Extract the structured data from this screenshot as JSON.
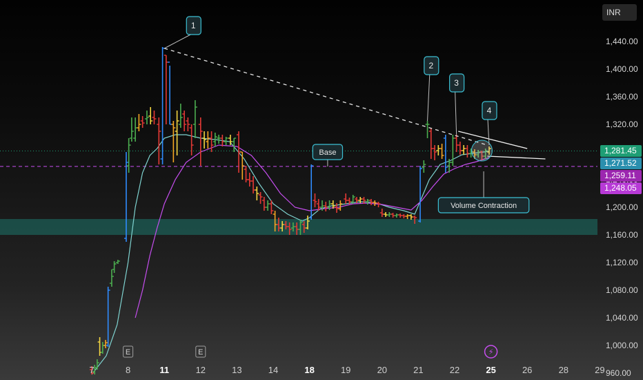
{
  "currency": "INR",
  "colors": {
    "bull_green": "#4caf50",
    "bear_red": "#e53935",
    "yellow": "#f5d742",
    "orange": "#f5a623",
    "blue": "#2f8cff",
    "ma_fast": "#7fd3d0",
    "ma_slow": "#c74ef0",
    "zone": "#1c5e55",
    "label": "#3cc0d4"
  },
  "price_tags": [
    {
      "label": "1,281.45",
      "value": 1281.45,
      "bg": "#1e9e75",
      "fg": "#ffffff"
    },
    {
      "label": "1,271.52",
      "value": 1271.52,
      "bg": "#2a8fae",
      "fg": "#ffffff"
    },
    {
      "label": "1,259.11",
      "value": 1259.11,
      "bg": "#9c27b0",
      "fg": "#ffffff"
    },
    {
      "label": "1,248.05",
      "value": 1248.05,
      "bg": "#b73ad6",
      "fg": "#ffffff"
    }
  ],
  "chart_data": {
    "type": "candlestick",
    "y_ticks": [
      "1,440.00",
      "1,400.00",
      "1,360.00",
      "1,320.00",
      "1,280.00",
      "1,240.00",
      "1,200.00",
      "1,160.00",
      "1,120.00",
      "1,080.00",
      "1,040.00",
      "1,000.00",
      "960.00"
    ],
    "y_tick_values": [
      1440,
      1400,
      1360,
      1320,
      1280,
      1240,
      1200,
      1160,
      1120,
      1080,
      1040,
      1000,
      960
    ],
    "x_ticks": [
      {
        "label": "7",
        "bold": false,
        "pos": 0
      },
      {
        "label": "8",
        "bold": false,
        "pos": 1
      },
      {
        "label": "11",
        "bold": true,
        "pos": 2
      },
      {
        "label": "12",
        "bold": false,
        "pos": 3
      },
      {
        "label": "13",
        "bold": false,
        "pos": 4
      },
      {
        "label": "14",
        "bold": false,
        "pos": 5
      },
      {
        "label": "18",
        "bold": true,
        "pos": 6
      },
      {
        "label": "19",
        "bold": false,
        "pos": 7
      },
      {
        "label": "20",
        "bold": false,
        "pos": 8
      },
      {
        "label": "21",
        "bold": false,
        "pos": 9
      },
      {
        "label": "22",
        "bold": false,
        "pos": 10
      },
      {
        "label": "25",
        "bold": true,
        "pos": 11
      },
      {
        "label": "26",
        "bold": false,
        "pos": 12
      },
      {
        "label": "28",
        "bold": false,
        "pos": 13
      },
      {
        "label": "29",
        "bold": false,
        "pos": 14
      }
    ],
    "event_markers": [
      {
        "label": "E",
        "pos": 1
      },
      {
        "label": "E",
        "pos": 3
      },
      {
        "label": "⚡",
        "pos": 11
      }
    ],
    "demand_zone": [
      1160,
      1183
    ],
    "ref_lines": [
      {
        "value": 1281.45,
        "style": "dotted",
        "color": "#1e9e75"
      },
      {
        "value": 1259.11,
        "style": "dashed",
        "color": "#c74ef0"
      }
    ],
    "trendline": {
      "from": [
        2,
        1430
      ],
      "to": [
        10.9,
        1290
      ]
    },
    "triangle": {
      "upper_from": [
        10.1,
        1310
      ],
      "upper_to": [
        12,
        1285
      ],
      "lower_from": [
        10.9,
        1274
      ],
      "lower_to": [
        12.5,
        1270
      ]
    },
    "annotations": [
      {
        "label": "1",
        "pos": 2.8,
        "value": 1463,
        "target_pos": 2,
        "target_value": 1430
      },
      {
        "label": "2",
        "pos": 9.35,
        "value": 1405,
        "target_pos": 9.25,
        "target_value": 1325
      },
      {
        "label": "3",
        "pos": 10.05,
        "value": 1380,
        "target_pos": 10.05,
        "target_value": 1305
      },
      {
        "label": "4",
        "pos": 10.95,
        "value": 1340,
        "target_pos": 10.95,
        "target_value": 1290
      }
    ],
    "callouts": [
      {
        "label": "Base",
        "pos": 6.5,
        "value": 1280,
        "target_pos": 6.5,
        "target_value": 1259
      },
      {
        "label": "Volume Contraction",
        "pos": 10.8,
        "value": 1203,
        "target_pos": 10.8,
        "target_value": 1252
      }
    ],
    "contraction_circle": {
      "pos": 10.75,
      "value": 1282
    },
    "candles": [
      [
        0.0,
        965,
        960,
        970,
        958
      ],
      [
        0.08,
        962,
        968,
        972,
        958
      ],
      [
        0.15,
        968,
        975,
        980,
        965
      ],
      [
        0.22,
        1005,
        990,
        1012,
        985
      ],
      [
        0.3,
        990,
        1000,
        1005,
        988
      ],
      [
        0.38,
        1000,
        1004,
        1008,
        996
      ],
      [
        0.45,
        1000,
        1080,
        1085,
        998
      ],
      [
        0.55,
        1090,
        1100,
        1110,
        1085
      ],
      [
        0.62,
        1110,
        1118,
        1122,
        1105
      ],
      [
        0.72,
        1120,
        1122,
        1124,
        1118
      ],
      [
        0.95,
        1155,
        1265,
        1280,
        1150
      ],
      [
        1.02,
        1260,
        1290,
        1300,
        1250
      ],
      [
        1.1,
        1300,
        1310,
        1330,
        1295
      ],
      [
        1.2,
        1300,
        1315,
        1330,
        1295
      ],
      [
        1.3,
        1315,
        1320,
        1335,
        1310
      ],
      [
        1.4,
        1325,
        1322,
        1332,
        1315
      ],
      [
        1.52,
        1328,
        1330,
        1340,
        1320
      ],
      [
        1.62,
        1332,
        1325,
        1345,
        1320
      ],
      [
        1.72,
        1330,
        1328,
        1340,
        1320
      ],
      [
        1.85,
        1320,
        1310,
        1330,
        1262
      ],
      [
        1.95,
        1270,
        1430,
        1432,
        1262
      ],
      [
        2.05,
        1420,
        1410,
        1420,
        1320
      ],
      [
        2.15,
        1410,
        1320,
        1405,
        1320
      ],
      [
        2.25,
        1320,
        1315,
        1325,
        1265
      ],
      [
        2.35,
        1310,
        1325,
        1340,
        1275
      ],
      [
        2.45,
        1320,
        1330,
        1350,
        1315
      ],
      [
        2.55,
        1335,
        1320,
        1340,
        1310
      ],
      [
        2.65,
        1325,
        1320,
        1330,
        1310
      ],
      [
        2.75,
        1315,
        1290,
        1320,
        1275
      ],
      [
        2.85,
        1320,
        1345,
        1355,
        1300
      ],
      [
        3.0,
        1320,
        1310,
        1330,
        1260
      ],
      [
        3.1,
        1300,
        1298,
        1310,
        1285
      ],
      [
        3.2,
        1295,
        1300,
        1310,
        1285
      ],
      [
        3.3,
        1300,
        1290,
        1310,
        1280
      ],
      [
        3.4,
        1295,
        1302,
        1308,
        1288
      ],
      [
        3.5,
        1300,
        1300,
        1305,
        1292
      ],
      [
        3.6,
        1300,
        1295,
        1305,
        1288
      ],
      [
        3.7,
        1295,
        1300,
        1302,
        1290
      ],
      [
        3.82,
        1300,
        1295,
        1305,
        1290
      ],
      [
        3.92,
        1295,
        1300,
        1300,
        1280
      ],
      [
        4.05,
        1305,
        1280,
        1310,
        1250
      ],
      [
        4.15,
        1280,
        1260,
        1280,
        1240
      ],
      [
        4.25,
        1255,
        1240,
        1260,
        1236
      ],
      [
        4.35,
        1240,
        1238,
        1250,
        1230
      ],
      [
        4.45,
        1238,
        1225,
        1245,
        1220
      ],
      [
        4.55,
        1225,
        1220,
        1230,
        1210
      ],
      [
        4.65,
        1218,
        1215,
        1222,
        1205
      ],
      [
        4.75,
        1210,
        1200,
        1215,
        1195
      ],
      [
        4.85,
        1200,
        1205,
        1210,
        1195
      ],
      [
        4.95,
        1205,
        1195,
        1210,
        1190
      ],
      [
        5.05,
        1190,
        1175,
        1195,
        1165
      ],
      [
        5.15,
        1175,
        1170,
        1185,
        1165
      ],
      [
        5.25,
        1170,
        1175,
        1180,
        1165
      ],
      [
        5.35,
        1175,
        1172,
        1180,
        1168
      ],
      [
        5.45,
        1172,
        1168,
        1178,
        1160
      ],
      [
        5.55,
        1170,
        1172,
        1178,
        1165
      ],
      [
        5.65,
        1172,
        1168,
        1178,
        1160
      ],
      [
        5.75,
        1168,
        1178,
        1182,
        1160
      ],
      [
        5.85,
        1175,
        1170,
        1180,
        1163
      ],
      [
        5.95,
        1170,
        1180,
        1188,
        1168
      ],
      [
        6.05,
        1185,
        1260,
        1262,
        1182
      ],
      [
        6.15,
        1210,
        1208,
        1220,
        1200
      ],
      [
        6.25,
        1205,
        1200,
        1212,
        1195
      ],
      [
        6.35,
        1200,
        1202,
        1210,
        1195
      ],
      [
        6.45,
        1202,
        1200,
        1208,
        1194
      ],
      [
        6.55,
        1200,
        1205,
        1210,
        1196
      ],
      [
        6.65,
        1205,
        1202,
        1210,
        1198
      ],
      [
        6.75,
        1200,
        1198,
        1206,
        1192
      ],
      [
        6.85,
        1198,
        1205,
        1210,
        1195
      ],
      [
        7.0,
        1212,
        1210,
        1220,
        1205
      ],
      [
        7.1,
        1210,
        1208,
        1214,
        1204
      ],
      [
        7.2,
        1208,
        1215,
        1218,
        1205
      ],
      [
        7.3,
        1212,
        1210,
        1215,
        1206
      ],
      [
        7.4,
        1210,
        1212,
        1215,
        1206
      ],
      [
        7.5,
        1212,
        1210,
        1215,
        1205
      ],
      [
        7.6,
        1208,
        1210,
        1212,
        1204
      ],
      [
        7.7,
        1210,
        1207,
        1212,
        1203
      ],
      [
        7.8,
        1207,
        1206,
        1210,
        1202
      ],
      [
        7.9,
        1206,
        1205,
        1208,
        1200
      ],
      [
        8.0,
        1192,
        1190,
        1198,
        1186
      ],
      [
        8.1,
        1190,
        1189,
        1193,
        1186
      ],
      [
        8.2,
        1189,
        1190,
        1193,
        1186
      ],
      [
        8.3,
        1190,
        1188,
        1192,
        1185
      ],
      [
        8.4,
        1188,
        1189,
        1191,
        1185
      ],
      [
        8.5,
        1189,
        1188,
        1191,
        1185
      ],
      [
        8.6,
        1188,
        1187,
        1190,
        1184
      ],
      [
        8.7,
        1187,
        1188,
        1190,
        1183
      ],
      [
        8.8,
        1188,
        1186,
        1190,
        1182
      ],
      [
        8.9,
        1186,
        1185,
        1188,
        1176
      ],
      [
        9.05,
        1180,
        1256,
        1260,
        1178
      ],
      [
        9.15,
        1258,
        1262,
        1268,
        1250
      ],
      [
        9.25,
        1320,
        1320,
        1325,
        1300
      ],
      [
        9.35,
        1310,
        1285,
        1315,
        1270
      ],
      [
        9.45,
        1285,
        1280,
        1290,
        1268
      ],
      [
        9.55,
        1282,
        1285,
        1290,
        1275
      ],
      [
        9.65,
        1285,
        1275,
        1292,
        1270
      ],
      [
        9.75,
        1300,
        1258,
        1305,
        1250
      ],
      [
        9.85,
        1260,
        1265,
        1270,
        1250
      ],
      [
        9.95,
        1265,
        1300,
        1305,
        1260
      ],
      [
        10.05,
        1300,
        1290,
        1305,
        1280
      ],
      [
        10.15,
        1290,
        1282,
        1295,
        1276
      ],
      [
        10.25,
        1282,
        1285,
        1290,
        1276
      ],
      [
        10.35,
        1285,
        1278,
        1290,
        1272
      ],
      [
        10.45,
        1278,
        1280,
        1285,
        1272
      ],
      [
        10.55,
        1280,
        1276,
        1284,
        1270
      ],
      [
        10.65,
        1276,
        1280,
        1283,
        1272
      ],
      [
        10.75,
        1280,
        1274,
        1282,
        1268
      ],
      [
        10.85,
        1274,
        1282,
        1285,
        1270
      ],
      [
        10.95,
        1280,
        1285,
        1288,
        1276
      ]
    ],
    "ma_fast": [
      [
        0.0,
        958
      ],
      [
        0.4,
        985
      ],
      [
        0.7,
        1030
      ],
      [
        1.0,
        1120
      ],
      [
        1.2,
        1200
      ],
      [
        1.4,
        1250
      ],
      [
        1.6,
        1275
      ],
      [
        1.8,
        1285
      ],
      [
        2.0,
        1300
      ],
      [
        2.3,
        1305
      ],
      [
        2.6,
        1305
      ],
      [
        3.0,
        1300
      ],
      [
        3.4,
        1298
      ],
      [
        3.8,
        1295
      ],
      [
        4.2,
        1270
      ],
      [
        4.6,
        1235
      ],
      [
        5.0,
        1205
      ],
      [
        5.4,
        1190
      ],
      [
        5.8,
        1180
      ],
      [
        6.0,
        1185
      ],
      [
        6.3,
        1198
      ],
      [
        6.6,
        1202
      ],
      [
        7.0,
        1205
      ],
      [
        7.4,
        1208
      ],
      [
        7.8,
        1207
      ],
      [
        8.2,
        1200
      ],
      [
        8.6,
        1195
      ],
      [
        8.9,
        1190
      ],
      [
        9.1,
        1215
      ],
      [
        9.3,
        1240
      ],
      [
        9.6,
        1262
      ],
      [
        9.9,
        1268
      ],
      [
        10.2,
        1276
      ],
      [
        10.5,
        1278
      ],
      [
        10.8,
        1280
      ],
      [
        10.95,
        1281
      ]
    ],
    "ma_slow": [
      [
        1.2,
        1040
      ],
      [
        1.4,
        1080
      ],
      [
        1.6,
        1130
      ],
      [
        1.8,
        1170
      ],
      [
        2.0,
        1205
      ],
      [
        2.3,
        1240
      ],
      [
        2.6,
        1265
      ],
      [
        3.0,
        1280
      ],
      [
        3.5,
        1290
      ],
      [
        4.0,
        1288
      ],
      [
        4.4,
        1275
      ],
      [
        4.8,
        1250
      ],
      [
        5.2,
        1220
      ],
      [
        5.6,
        1200
      ],
      [
        6.0,
        1195
      ],
      [
        6.4,
        1198
      ],
      [
        6.8,
        1200
      ],
      [
        7.2,
        1205
      ],
      [
        7.6,
        1206
      ],
      [
        8.0,
        1204
      ],
      [
        8.4,
        1200
      ],
      [
        8.8,
        1196
      ],
      [
        9.1,
        1210
      ],
      [
        9.4,
        1230
      ],
      [
        9.7,
        1248
      ],
      [
        10.0,
        1256
      ],
      [
        10.3,
        1262
      ],
      [
        10.6,
        1266
      ],
      [
        10.95,
        1272
      ]
    ]
  }
}
